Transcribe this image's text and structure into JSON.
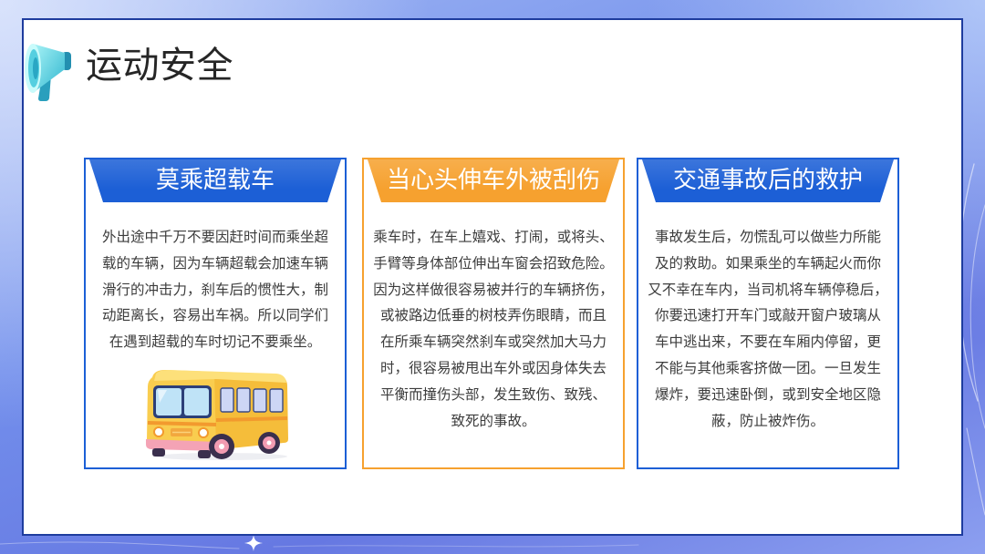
{
  "slide": {
    "title": "运动安全"
  },
  "icons": {
    "title_icon": "megaphone-icon",
    "decoration": "sparkle-icon"
  },
  "colors": {
    "frame": "#1e3c9e",
    "body_text": "#3c3c3c"
  },
  "cards": [
    {
      "title": "莫乘超载车",
      "accent": "#1c5fd6",
      "illustration": "school-bus-icon",
      "lines": [
        "外出途中千万不要因赶时间而乘坐超",
        "载的车辆，因为车辆超载会加速车辆",
        "滑行的冲击力，刹车后的惯性大，制",
        "动距离长，容易出车祸。所以同学们",
        "在遇到超载的车时切记不要乘坐。"
      ]
    },
    {
      "title": "当心头伸车外被刮伤",
      "accent": "#f6a12f",
      "lines": [
        "乘车时，在车上嬉戏、打闹，或将头、",
        "手臂等身体部位伸出车窗会招致危险。",
        "因为这样做很容易被并行的车辆挤伤，",
        "或被路边低垂的树枝弄伤眼睛，而且",
        "在所乘车辆突然刹车或突然加大马力",
        "时，很容易被甩出车外或因身体失去",
        "平衡而撞伤头部，发生致伤、致残、",
        "致死的事故。"
      ]
    },
    {
      "title": "交通事故后的救护",
      "accent": "#1c5fd6",
      "lines": [
        "事故发生后，勿慌乱可以做些力所能",
        "及的救助。如果乘坐的车辆起火而你",
        "又不幸在车内，当司机将车辆停稳后，",
        "你要迅速打开车门或敲开窗户玻璃从",
        "车中逃出来，不要在车厢内停留，更",
        "不能与其他乘客挤做一团。一旦发生",
        "爆炸，要迅速卧倒，或到安全地区隐",
        "蔽，防止被炸伤。"
      ]
    }
  ]
}
